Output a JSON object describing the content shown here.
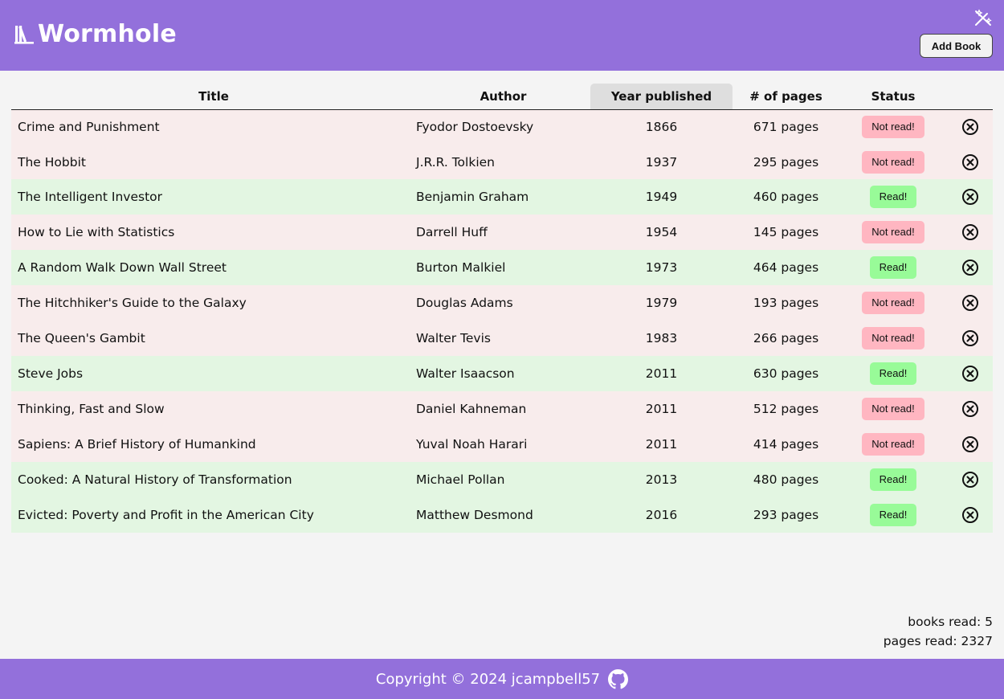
{
  "app": {
    "title": "Wormhole",
    "logo_icon": "books-icon",
    "theme_icon": "magic-wand-off-icon",
    "add_book_label": "Add Book",
    "brand_color": "#9370db"
  },
  "table": {
    "headers": [
      "Title",
      "Author",
      "Year published",
      "# of pages",
      "Status"
    ],
    "sorted_column": "Year published",
    "rows": [
      {
        "title": "Crime and Punishment",
        "author": "Fyodor Dostoevsky",
        "year": "1866",
        "pages": "671 pages",
        "status": "Not read!",
        "read": false
      },
      {
        "title": "The Hobbit",
        "author": "J.R.R. Tolkien",
        "year": "1937",
        "pages": "295 pages",
        "status": "Not read!",
        "read": false
      },
      {
        "title": "The Intelligent Investor",
        "author": "Benjamin Graham",
        "year": "1949",
        "pages": "460 pages",
        "status": "Read!",
        "read": true
      },
      {
        "title": "How to Lie with Statistics",
        "author": "Darrell Huff",
        "year": "1954",
        "pages": "145 pages",
        "status": "Not read!",
        "read": false
      },
      {
        "title": "A Random Walk Down Wall Street",
        "author": "Burton Malkiel",
        "year": "1973",
        "pages": "464 pages",
        "status": "Read!",
        "read": true
      },
      {
        "title": "The Hitchhiker's Guide to the Galaxy",
        "author": "Douglas Adams",
        "year": "1979",
        "pages": "193 pages",
        "status": "Not read!",
        "read": false
      },
      {
        "title": "The Queen's Gambit",
        "author": "Walter Tevis",
        "year": "1983",
        "pages": "266 pages",
        "status": "Not read!",
        "read": false
      },
      {
        "title": "Steve Jobs",
        "author": "Walter Isaacson",
        "year": "2011",
        "pages": "630 pages",
        "status": "Read!",
        "read": true
      },
      {
        "title": "Thinking, Fast and Slow",
        "author": "Daniel Kahneman",
        "year": "2011",
        "pages": "512 pages",
        "status": "Not read!",
        "read": false
      },
      {
        "title": "Sapiens: A Brief History of Humankind",
        "author": "Yuval Noah Harari",
        "year": "2011",
        "pages": "414 pages",
        "status": "Not read!",
        "read": false
      },
      {
        "title": "Cooked: A Natural History of Transformation",
        "author": "Michael Pollan",
        "year": "2013",
        "pages": "480 pages",
        "status": "Read!",
        "read": true
      },
      {
        "title": "Evicted: Poverty and Profit in the American City",
        "author": "Matthew Desmond",
        "year": "2016",
        "pages": "293 pages",
        "status": "Read!",
        "read": true
      }
    ]
  },
  "stats": {
    "books_read": "books read: 5",
    "pages_read": "pages read: 2327"
  },
  "footer": {
    "copyright": "Copyright © 2024 jcampbell57",
    "github_icon": "github-icon"
  },
  "colors": {
    "not_read_badge": "#ffb6c1",
    "read_badge": "#98fb98",
    "not_read_row": "#f8ecec",
    "read_row": "#e3f6e2"
  }
}
